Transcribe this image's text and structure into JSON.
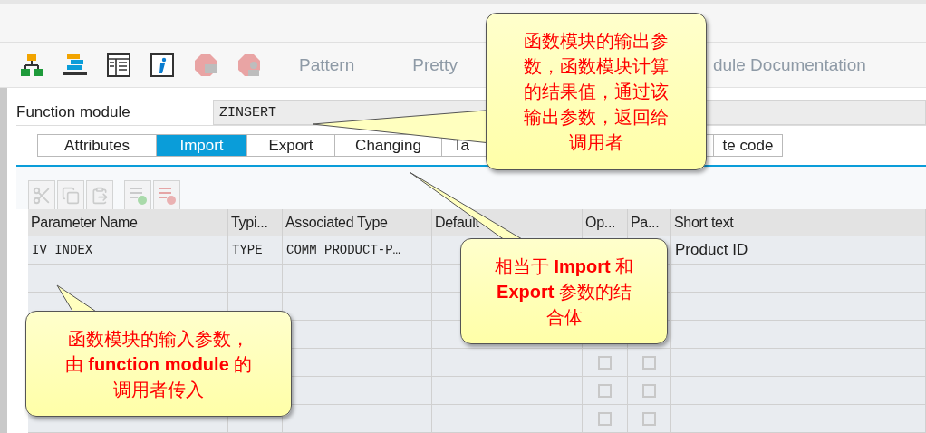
{
  "toolbar": {
    "items": [
      {
        "kind": "icon",
        "disabled": false
      },
      {
        "kind": "icon",
        "disabled": false
      },
      {
        "kind": "icon",
        "disabled": false
      },
      {
        "kind": "icon",
        "disabled": false
      },
      {
        "kind": "icon",
        "disabled": true
      },
      {
        "kind": "icon",
        "disabled": true
      },
      {
        "kind": "text",
        "label": "Pattern",
        "disabled": true
      },
      {
        "kind": "text",
        "label": "Pretty",
        "disabled": true
      },
      {
        "kind": "text",
        "label": "dule Documentation",
        "disabled": true
      }
    ]
  },
  "function_module": {
    "label": "Function module",
    "value": "ZINSERT"
  },
  "tabs": [
    {
      "label": "Attributes",
      "selected": false
    },
    {
      "label": "Import",
      "selected": true
    },
    {
      "label": "Export",
      "selected": false
    },
    {
      "label": "Changing",
      "selected": false
    },
    {
      "label": "Ta",
      "selected": false
    },
    {
      "label": "te code",
      "selected": false
    }
  ],
  "table_toolbar": [
    {
      "disabled": true
    },
    {
      "disabled": true
    },
    {
      "disabled": true
    },
    {
      "disabled": true
    },
    {
      "disabled": true
    }
  ],
  "table": {
    "columns": [
      "Parameter Name",
      "Typi...",
      "Associated Type",
      "Default",
      "Op...",
      "Pa...",
      "Short text"
    ],
    "rows": [
      {
        "cells": [
          "IV_INDEX",
          "TYPE",
          "COMM_PRODUCT-P…",
          "",
          "",
          "",
          "Product ID"
        ]
      },
      {
        "cells": [
          "",
          "",
          "",
          "",
          "",
          "",
          ""
        ]
      },
      {
        "cells": [
          "",
          "",
          "",
          "",
          "",
          "",
          ""
        ]
      },
      {
        "cells": [
          "",
          "",
          "",
          "",
          "",
          "",
          ""
        ]
      },
      {
        "cells": [
          "",
          "",
          "",
          "",
          "",
          "",
          ""
        ],
        "optional": false,
        "pass_value": false
      },
      {
        "cells": [
          "",
          "",
          "",
          "",
          "",
          "",
          ""
        ],
        "optional": false,
        "pass_value": false
      },
      {
        "cells": [
          "",
          "",
          "",
          "",
          "",
          "",
          ""
        ],
        "optional": false,
        "pass_value": false
      }
    ]
  },
  "callouts": [
    {
      "text": "函数模块的输出参数，函数模块计算的结果值，通过该输出参数，返回给调用者"
    },
    {
      "text": "相当于 **Import** 和 **Export** 参数的结合体"
    },
    {
      "text": "函数模块的输入参数，由 **function module** 的调用者传入"
    }
  ]
}
